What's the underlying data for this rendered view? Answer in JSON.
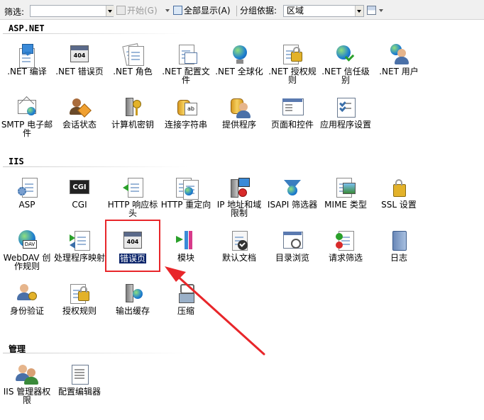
{
  "toolbar": {
    "filter_label": "筛选:",
    "filter_value": "",
    "start_label": "开始(G)",
    "show_all_label": "全部显示(A)",
    "group_by_label": "分组依据:",
    "group_by_value": "区域",
    "view_icon": "view-icon"
  },
  "sections": [
    {
      "title": "ASP.NET",
      "items": [
        {
          "label": ".NET 编译",
          "icon": "dotnet-compile-icon"
        },
        {
          "label": ".NET 错误页",
          "icon": "dotnet-error-page-icon"
        },
        {
          "label": ".NET 角色",
          "icon": "dotnet-roles-icon"
        },
        {
          "label": ".NET 配置文件",
          "icon": "dotnet-profile-icon"
        },
        {
          "label": ".NET 全球化",
          "icon": "dotnet-globalization-icon"
        },
        {
          "label": ".NET 授权规则",
          "icon": "dotnet-authorization-icon"
        },
        {
          "label": ".NET 信任级别",
          "icon": "dotnet-trust-level-icon"
        },
        {
          "label": ".NET 用户",
          "icon": "dotnet-users-icon"
        },
        {
          "label": "SMTP 电子邮件",
          "icon": "smtp-email-icon"
        },
        {
          "label": "会话状态",
          "icon": "session-state-icon"
        },
        {
          "label": "计算机密钥",
          "icon": "machine-key-icon"
        },
        {
          "label": "连接字符串",
          "icon": "connection-strings-icon"
        },
        {
          "label": "提供程序",
          "icon": "providers-icon"
        },
        {
          "label": "页面和控件",
          "icon": "pages-controls-icon"
        },
        {
          "label": "应用程序设置",
          "icon": "app-settings-icon"
        }
      ]
    },
    {
      "title": "IIS",
      "items": [
        {
          "label": "ASP",
          "icon": "asp-icon"
        },
        {
          "label": "CGI",
          "icon": "cgi-icon"
        },
        {
          "label": "HTTP 响应标头",
          "icon": "http-response-headers-icon"
        },
        {
          "label": "HTTP 重定向",
          "icon": "http-redirect-icon"
        },
        {
          "label": "IP 地址和域限制",
          "icon": "ip-domain-restrictions-icon"
        },
        {
          "label": "ISAPI 筛选器",
          "icon": "isapi-filters-icon"
        },
        {
          "label": "MIME 类型",
          "icon": "mime-types-icon"
        },
        {
          "label": "SSL 设置",
          "icon": "ssl-settings-icon"
        },
        {
          "label": "WebDAV 创作规则",
          "icon": "webdav-icon"
        },
        {
          "label": "处理程序映射",
          "icon": "handler-mappings-icon"
        },
        {
          "label": "错误页",
          "icon": "error-pages-icon",
          "selected": true
        },
        {
          "label": "模块",
          "icon": "modules-icon"
        },
        {
          "label": "默认文档",
          "icon": "default-document-icon"
        },
        {
          "label": "目录浏览",
          "icon": "directory-browsing-icon"
        },
        {
          "label": "请求筛选",
          "icon": "request-filtering-icon"
        },
        {
          "label": "日志",
          "icon": "logging-icon"
        },
        {
          "label": "身份验证",
          "icon": "authentication-icon"
        },
        {
          "label": "授权规则",
          "icon": "authorization-rules-icon"
        },
        {
          "label": "输出缓存",
          "icon": "output-caching-icon"
        },
        {
          "label": "压缩",
          "icon": "compression-icon"
        }
      ]
    },
    {
      "title": "管理",
      "items": [
        {
          "label": "IIS 管理器权限",
          "icon": "iis-manager-permissions-icon"
        },
        {
          "label": "配置编辑器",
          "icon": "configuration-editor-icon"
        }
      ]
    }
  ],
  "colors": {
    "selection": "#0a246a",
    "annotation": "#e8262a",
    "toolbar_bg": "#f0f0f0"
  }
}
